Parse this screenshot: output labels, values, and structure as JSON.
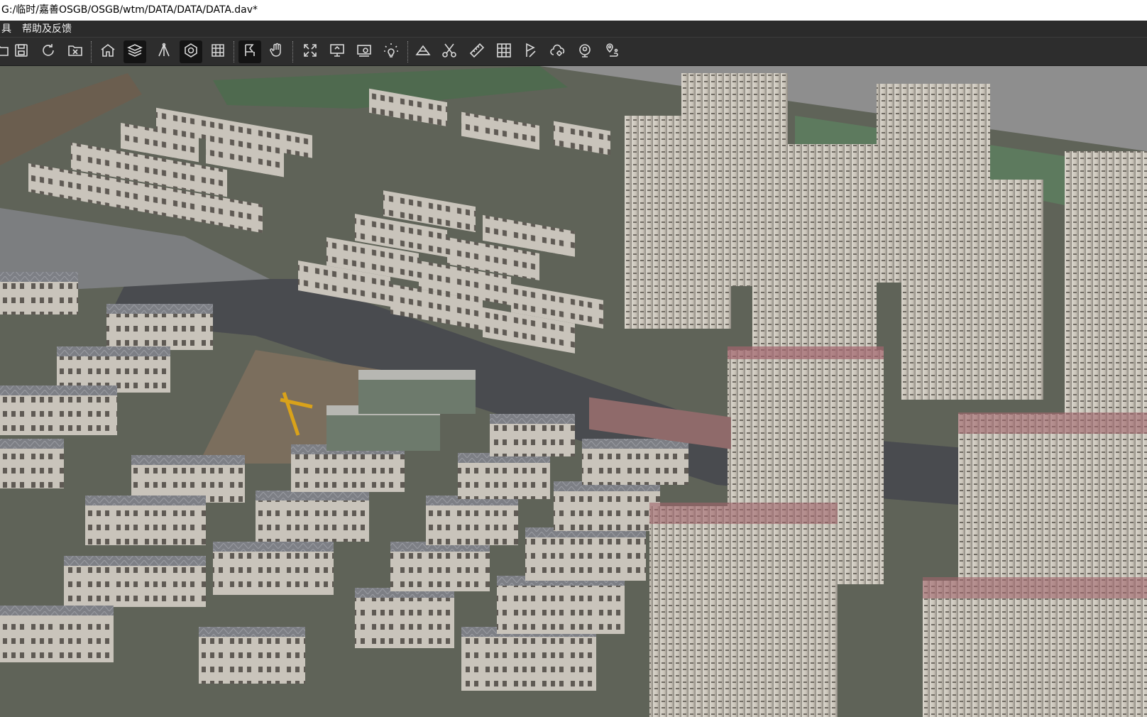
{
  "window": {
    "title": "G:/临时/嘉善OSGB/OSGB/wtm/DATA/DATA/DATA.dav*"
  },
  "menu": {
    "items": [
      {
        "label": "具"
      },
      {
        "label": "帮助及反馈"
      }
    ]
  },
  "toolbar": {
    "buttons": [
      {
        "icon": "folder-open-icon",
        "active": false
      },
      {
        "icon": "save-icon",
        "active": false
      },
      {
        "icon": "refresh-icon",
        "active": false
      },
      {
        "icon": "close-project-icon",
        "active": false
      },
      {
        "icon": "home-icon",
        "active": false
      },
      {
        "icon": "layers-icon",
        "active": true
      },
      {
        "icon": "tripod-icon",
        "active": false
      },
      {
        "icon": "target-icon",
        "active": true
      },
      {
        "icon": "grid-icon",
        "active": false
      },
      {
        "icon": "select-icon",
        "active": true
      },
      {
        "icon": "pan-hand-icon",
        "active": false
      },
      {
        "icon": "fullscreen-icon",
        "active": false
      },
      {
        "icon": "monitor-icon",
        "active": false
      },
      {
        "icon": "screenshot-icon",
        "active": false
      },
      {
        "icon": "light-icon",
        "active": false
      },
      {
        "icon": "terrain-icon",
        "active": false
      },
      {
        "icon": "cut-icon",
        "active": false
      },
      {
        "icon": "ruler-icon",
        "active": false
      },
      {
        "icon": "table-icon",
        "active": false
      },
      {
        "icon": "flag-icon",
        "active": false
      },
      {
        "icon": "cloud-gear-icon",
        "active": false
      },
      {
        "icon": "location-pin-icon",
        "active": false
      },
      {
        "icon": "route-icon",
        "active": false
      }
    ]
  },
  "viewport": {
    "content": "3D OSGB oblique photography model: residential district with villa rows, high-rise towers and roads"
  },
  "colors": {
    "titlebar_bg": "#ffffff",
    "menubar_bg": "#2b2b2b",
    "toolbar_bg": "#2d2d2d",
    "icon": "#d8d8d8",
    "sky": "#8e8e8e"
  }
}
